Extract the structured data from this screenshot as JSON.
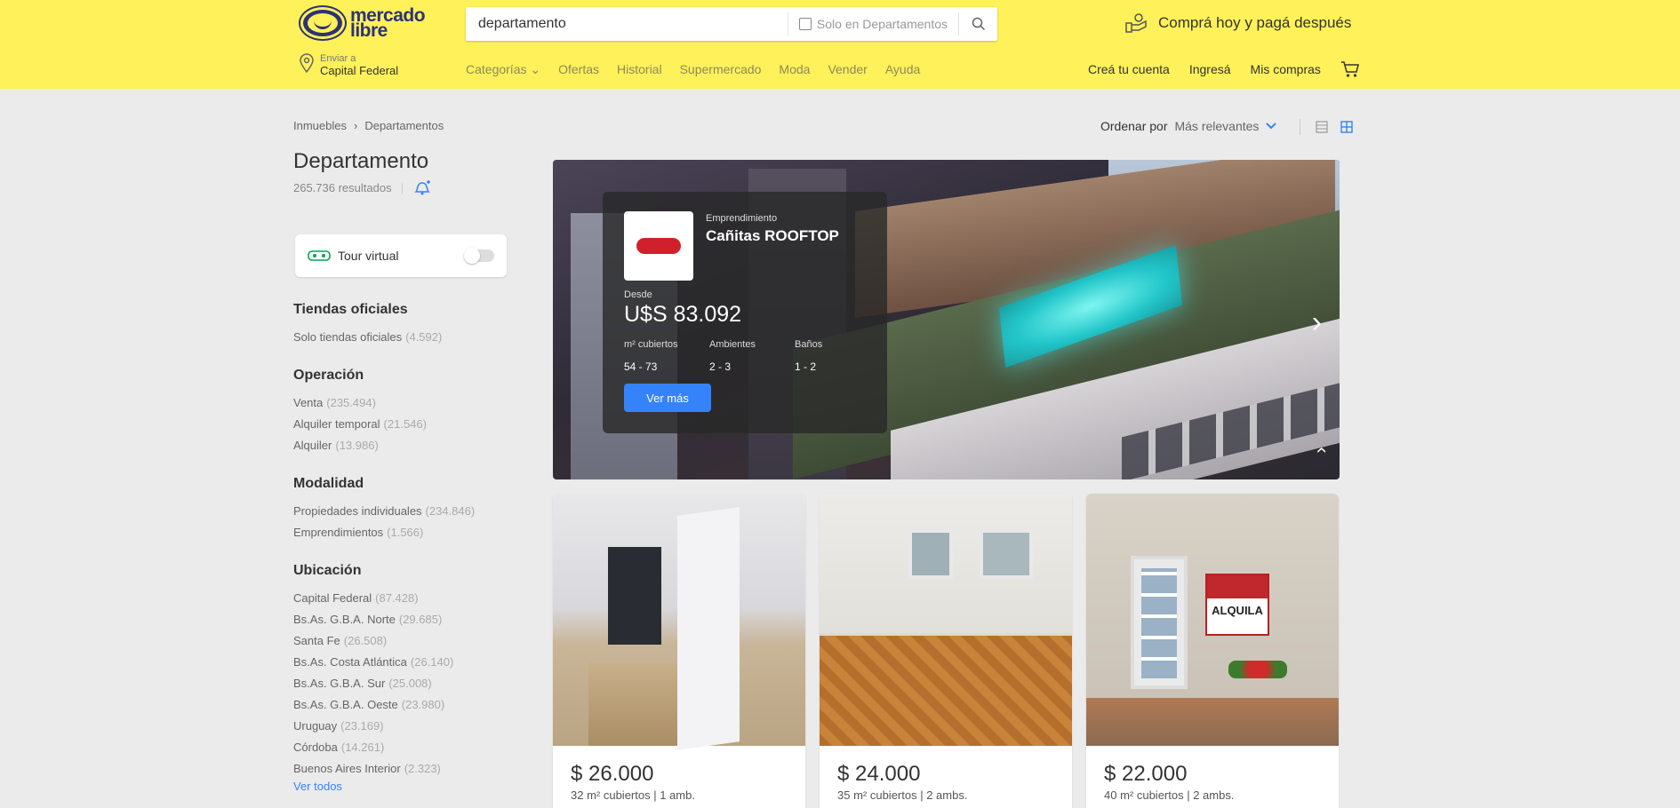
{
  "header": {
    "logo_text": "mercado libre",
    "search": {
      "value": "departamento",
      "filter_label": "Solo en Departamentos"
    },
    "promo": "Comprá hoy y pagá después",
    "location": {
      "label": "Enviar a",
      "value": "Capital Federal"
    },
    "nav": [
      "Categorías",
      "Ofertas",
      "Historial",
      "Supermercado",
      "Moda",
      "Vender",
      "Ayuda"
    ],
    "account": {
      "create": "Creá tu cuenta",
      "login": "Ingresá",
      "purchases": "Mis compras"
    }
  },
  "breadcrumb": [
    "Inmuebles",
    "Departamentos"
  ],
  "sort": {
    "label": "Ordenar por",
    "value": "Más relevantes"
  },
  "sidebar": {
    "title": "Departamento",
    "results": "265.736 resultados",
    "tour_label": "Tour virtual",
    "filters": [
      {
        "title": "Tiendas oficiales",
        "items": [
          {
            "label": "Solo tiendas oficiales",
            "count": "(4.592)"
          }
        ]
      },
      {
        "title": "Operación",
        "items": [
          {
            "label": "Venta",
            "count": "(235.494)"
          },
          {
            "label": "Alquiler temporal",
            "count": "(21.546)"
          },
          {
            "label": "Alquiler",
            "count": "(13.986)"
          }
        ]
      },
      {
        "title": "Modalidad",
        "items": [
          {
            "label": "Propiedades individuales",
            "count": "(234.846)"
          },
          {
            "label": "Emprendimientos",
            "count": "(1.566)"
          }
        ]
      },
      {
        "title": "Ubicación",
        "items": [
          {
            "label": "Capital Federal",
            "count": "(87.428)"
          },
          {
            "label": "Bs.As. G.B.A. Norte",
            "count": "(29.685)"
          },
          {
            "label": "Santa Fe",
            "count": "(26.508)"
          },
          {
            "label": "Bs.As. Costa Atlántica",
            "count": "(26.140)"
          },
          {
            "label": "Bs.As. G.B.A. Sur",
            "count": "(25.008)"
          },
          {
            "label": "Bs.As. G.B.A. Oeste",
            "count": "(23.980)"
          },
          {
            "label": "Uruguay",
            "count": "(23.169)"
          },
          {
            "label": "Córdoba",
            "count": "(14.261)"
          },
          {
            "label": "Buenos Aires Interior",
            "count": "(2.323)"
          }
        ]
      }
    ],
    "see_all": "Ver todos"
  },
  "hero": {
    "type": "Emprendimiento",
    "name": "Cañitas ROOFTOP",
    "from_label": "Desde",
    "price": "U$S 83.092",
    "stats": [
      {
        "label": "m² cubiertos",
        "value": "54 - 73"
      },
      {
        "label": "Ambientes",
        "value": "2 - 3"
      },
      {
        "label": "Baños",
        "value": "1 - 2"
      }
    ],
    "button": "Ver más"
  },
  "listings": [
    {
      "price": "$ 26.000",
      "info": "32 m² cubiertos | 1 amb."
    },
    {
      "price": "$ 24.000",
      "info": "35 m² cubiertos | 2 ambs."
    },
    {
      "price": "$ 22.000",
      "info": "40 m² cubiertos | 2 ambs.",
      "sign_text": "ALQUILA"
    }
  ],
  "colors": {
    "header_bg": "#fff159",
    "accent": "#3483fa",
    "brand_navy": "#2d3277"
  }
}
